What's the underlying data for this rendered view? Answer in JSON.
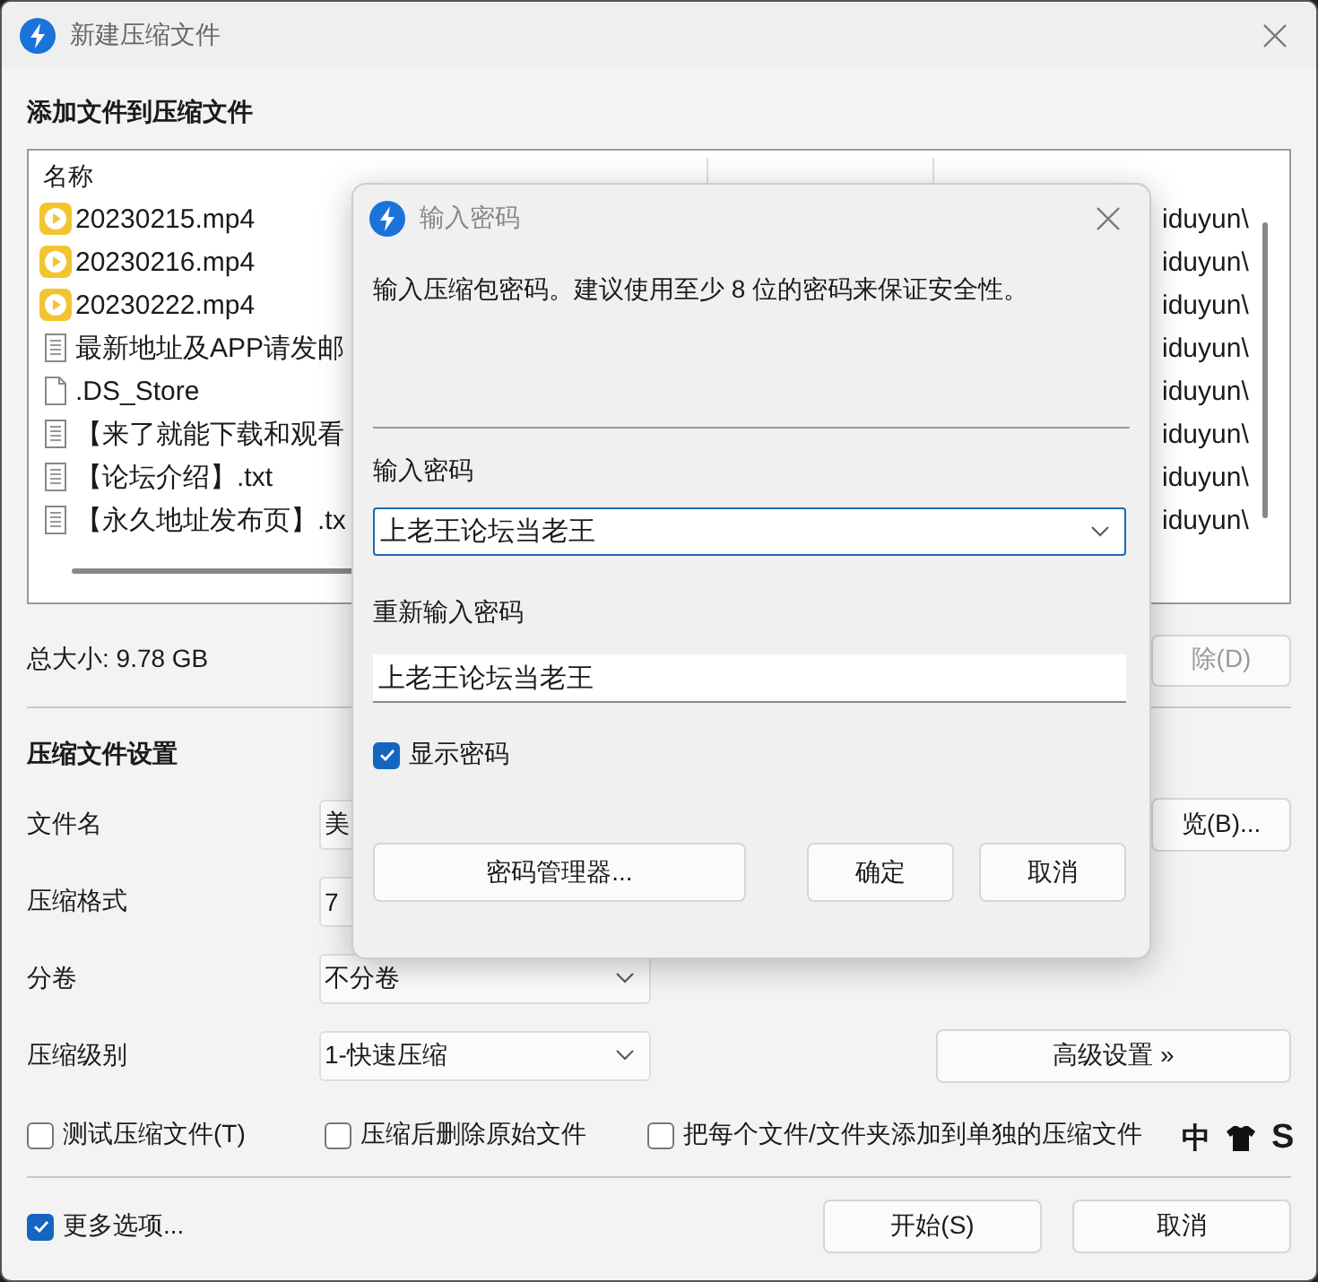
{
  "window": {
    "title": "新建压缩文件"
  },
  "files": {
    "section_title": "添加文件到压缩文件",
    "columns": [
      {
        "label": "名称"
      }
    ],
    "rows": [
      {
        "name": "20230215.mp4",
        "kind": "video",
        "path": "iduyun\\"
      },
      {
        "name": "20230216.mp4",
        "kind": "video",
        "path": "iduyun\\"
      },
      {
        "name": "20230222.mp4",
        "kind": "video",
        "path": "iduyun\\"
      },
      {
        "name": "最新地址及APP请发邮",
        "kind": "text",
        "path": "iduyun\\"
      },
      {
        "name": ".DS_Store",
        "kind": "blank",
        "path": "iduyun\\"
      },
      {
        "name": "【来了就能下载和观看",
        "kind": "text",
        "path": "iduyun\\"
      },
      {
        "name": "【论坛介绍】.txt",
        "kind": "text",
        "path": "iduyun\\"
      },
      {
        "name": "【永久地址发布页】.tx",
        "kind": "text",
        "path": "iduyun\\"
      }
    ],
    "total_size": "总大小: 9.78 GB",
    "delete_button": "除(D)"
  },
  "settings": {
    "section_title": "压缩文件设置",
    "fields": [
      {
        "label": "文件名",
        "kind": "text",
        "value": "美",
        "button": "览(B)..."
      },
      {
        "label": "压缩格式",
        "kind": "text",
        "value": "7"
      },
      {
        "label": "分卷",
        "kind": "combo",
        "value": "不分卷"
      },
      {
        "label": "压缩级别",
        "kind": "combo",
        "value": "1-快速压缩",
        "button": "高级设置 »"
      }
    ],
    "checkboxes": [
      {
        "label": "测试压缩文件(T)",
        "checked": false
      },
      {
        "label": "压缩后删除原始文件",
        "checked": false
      },
      {
        "label": "把每个文件/文件夹添加到单独的压缩文件",
        "checked": false
      }
    ],
    "more_options": {
      "label": "更多选项...",
      "checked": true
    }
  },
  "buttons": [
    "开始(S)",
    "取消"
  ],
  "ime_bar": {
    "mode": "中",
    "skin": "S"
  },
  "dialog": {
    "title": "输入密码",
    "message": "输入压缩包密码。建议使用至少 8 位的密码来保证安全性。",
    "password_label": "输入密码",
    "password": "上老王论坛当老王",
    "confirm_label": "重新输入密码",
    "confirm": "上老王论坛当老王",
    "show_password": {
      "label": "显示密码",
      "checked": true
    },
    "manager_button": "密码管理器...",
    "buttons": [
      "确定",
      "取消"
    ]
  }
}
